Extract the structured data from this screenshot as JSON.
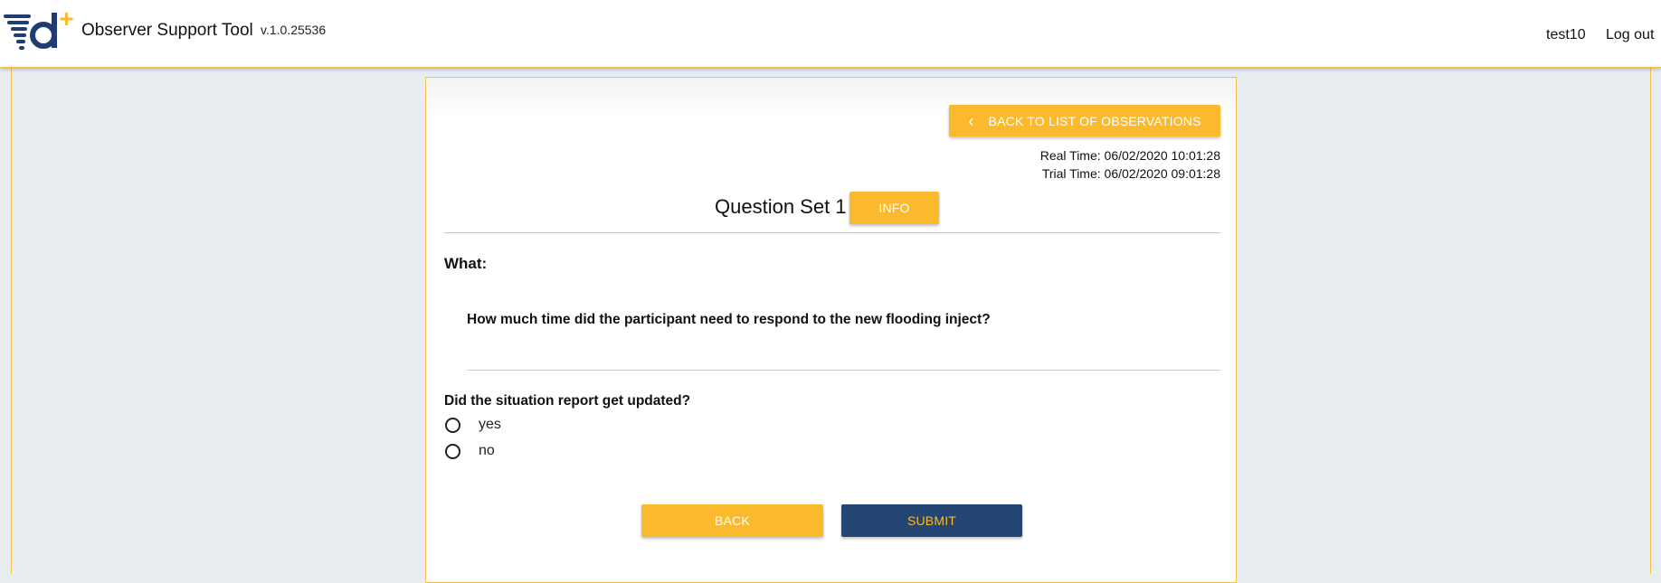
{
  "header": {
    "app_title": "Observer Support Tool",
    "version": "v.1.0.25536",
    "user": "test10",
    "logout_label": "Log out",
    "logo_icon": "drivers-plus-logo-icon"
  },
  "card": {
    "back_to_list_label": "BACK TO LIST OF OBSERVATIONS",
    "back_icon": "chevron-left-icon",
    "real_time": "Real Time: 06/02/2020 10:01:28",
    "trial_time": "Trial Time: 06/02/2020 09:01:28",
    "question_set_title": "Question Set 1",
    "info_label": "INFO",
    "what_label": "What:",
    "question_text": "How much time did the participant need to respond to the new flooding inject?",
    "answer_value": "",
    "radio_question": "Did the situation report get updated?",
    "radio_options": [
      "yes",
      "no"
    ],
    "back_label": "BACK",
    "submit_label": "SUBMIT"
  },
  "colors": {
    "accent_yellow": "#fbb92e",
    "navy": "#234675",
    "page_bg": "#e8edf2",
    "logo_blue": "#1f3d73"
  }
}
